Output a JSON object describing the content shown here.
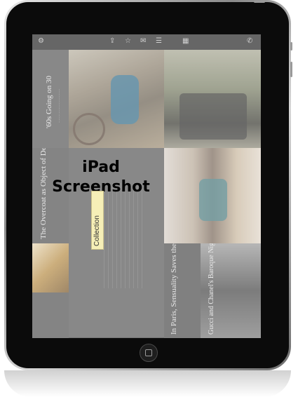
{
  "overlay": {
    "line1": "iPad",
    "line2": "Screenshot",
    "tooltip": "Collection"
  },
  "toolbar": {
    "icons": [
      "settings-icon",
      "share-icon",
      "star-icon",
      "mail-icon",
      "list-icon",
      "grid-icon",
      "phone-icon"
    ]
  },
  "cells": {
    "story1": {
      "title": "'60s Going on 30"
    },
    "story2": {
      "title": "The Overcoat as Object of Design"
    },
    "story3": {
      "title": "In Paris, Sensuality Saves the Day"
    },
    "story4": {
      "title": "Gucci and Chanel's Baroque Nights"
    }
  },
  "colors": {
    "bezel": "#0b0b0b",
    "screen_bg": "#3d3d3d",
    "tooltip_bg": "#f6efb7"
  }
}
